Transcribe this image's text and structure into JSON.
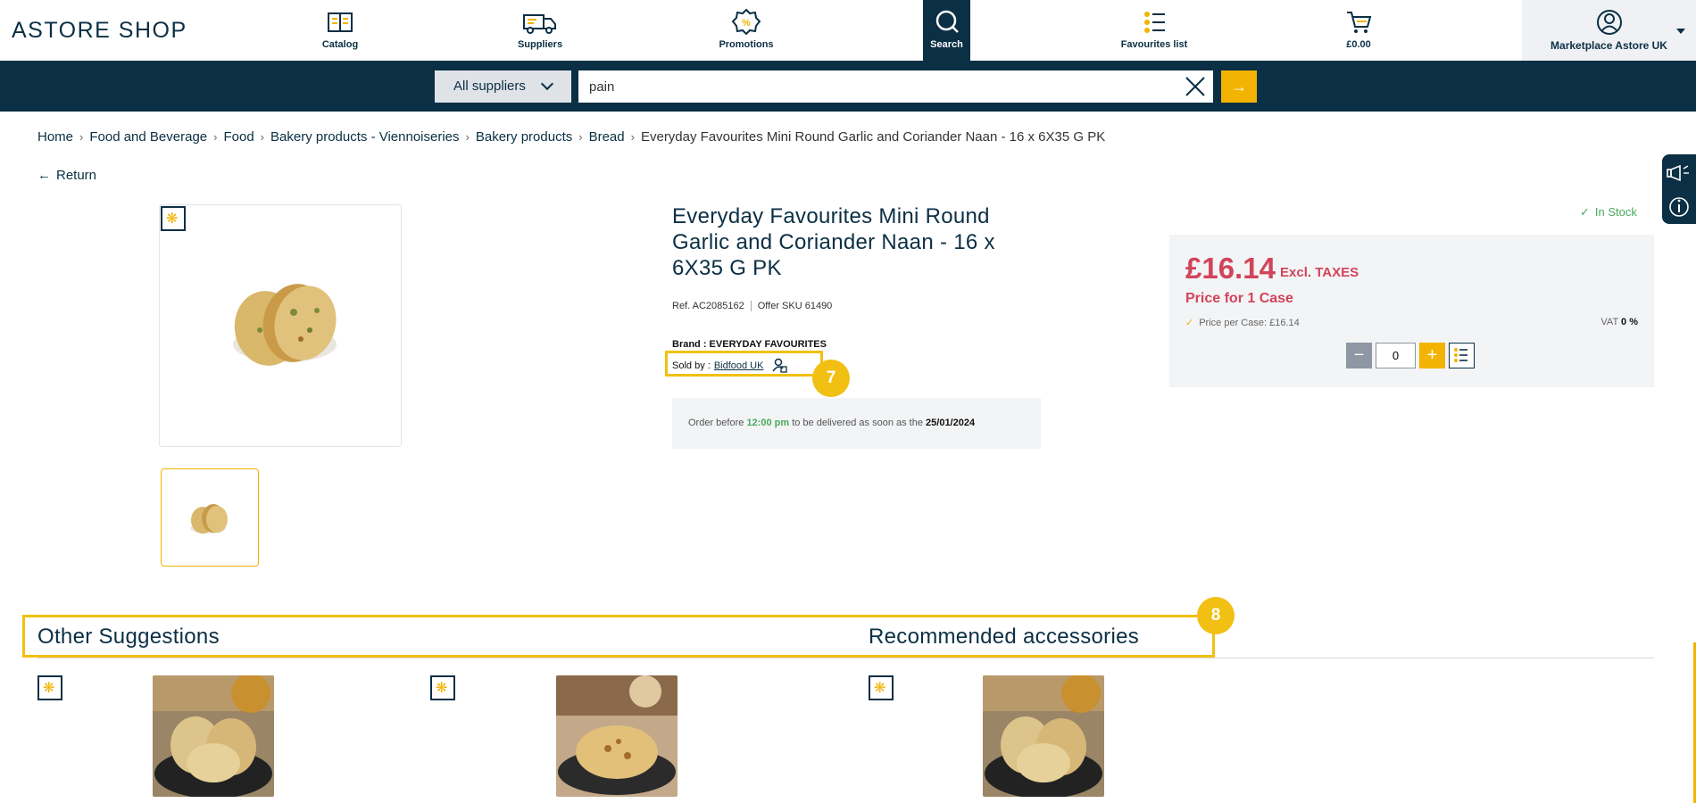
{
  "header": {
    "logo": "ASTORE SHOP",
    "nav": [
      {
        "label": "Catalog",
        "icon": "catalog-book-icon"
      },
      {
        "label": "Suppliers",
        "icon": "truck-icon"
      },
      {
        "label": "Promotions",
        "icon": "percent-badge-icon"
      },
      {
        "label": "Search",
        "icon": "search-icon"
      },
      {
        "label": "Favourites list",
        "icon": "list-icon"
      },
      {
        "label": "£0.00",
        "icon": "cart-icon"
      }
    ],
    "account": {
      "label": "Marketplace Astore UK",
      "icon": "user-icon"
    }
  },
  "search": {
    "supplier_filter": "All suppliers",
    "query": "pain",
    "go_label": "→"
  },
  "breadcrumb": [
    "Home",
    "Food and Beverage",
    "Food",
    "Bakery products - Viennoiseries",
    "Bakery products",
    "Bread"
  ],
  "breadcrumb_current": "Everyday Favourites Mini Round Garlic and Coriander Naan - 16 x 6X35 G PK",
  "return_label": "Return",
  "product": {
    "title": "Everyday Favourites Mini Round Garlic and Coriander Naan - 16 x 6X35 G PK",
    "ref": "Ref. AC2085162",
    "offer_sku": "Offer SKU 61490",
    "brand": "Brand : EVERYDAY FAVOURITES",
    "sold_by_label": "Sold by :",
    "seller": "Bidfood UK",
    "delivery_prefix": "Order before",
    "delivery_time": "12:00 pm",
    "delivery_middle": "to be delivered as soon as the",
    "delivery_date": "25/01/2024"
  },
  "pricing": {
    "stock": "In Stock",
    "price": "£16.14",
    "tax_label": "Excl. TAXES",
    "price_for": "Price for 1 Case",
    "price_per_case": "Price per Case: £16.14",
    "vat_label": "VAT",
    "vat_value": "0 %",
    "quantity": "0"
  },
  "annotations": {
    "step7": "7",
    "step8": "8"
  },
  "sections": {
    "suggestions_title": "Other Suggestions",
    "accessories_title": "Recommended accessories"
  },
  "colors": {
    "navy": "#0b2f44",
    "accent": "#f2b302",
    "price_red": "#d1445a",
    "stock_green": "#4aaa5b"
  }
}
